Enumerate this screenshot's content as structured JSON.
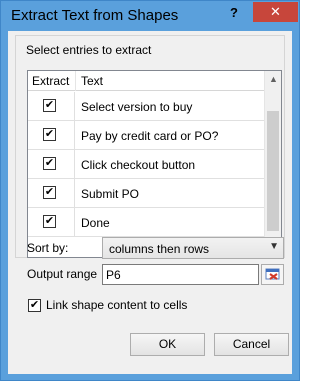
{
  "window": {
    "title": "Extract Text from Shapes",
    "help_label": "?",
    "close_label": "✕"
  },
  "group": {
    "label": "Select entries to extract"
  },
  "list": {
    "headers": [
      "Extract",
      "Text"
    ],
    "rows": [
      {
        "checked": true,
        "text": "Select version to buy"
      },
      {
        "checked": true,
        "text": "Pay by credit card or PO?"
      },
      {
        "checked": true,
        "text": "Click checkout button"
      },
      {
        "checked": true,
        "text": "Submit PO"
      },
      {
        "checked": true,
        "text": "Done"
      }
    ],
    "check_glyph": "✔"
  },
  "form": {
    "sort_label": "Sort by:",
    "sort_value": "columns then rows",
    "output_label": "Output range",
    "output_value": "P6",
    "link_checked": true,
    "link_label": "Link shape content to cells"
  },
  "buttons": {
    "ok": "OK",
    "cancel": "Cancel"
  },
  "icons": {
    "scroll_up": "up-arrow-icon",
    "scroll_down": "down-arrow-icon",
    "range_picker": "range-picker-icon"
  }
}
